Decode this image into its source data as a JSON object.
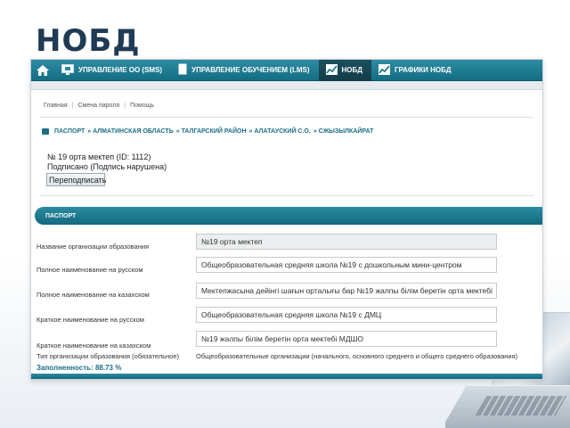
{
  "slide": {
    "title": "НОБД"
  },
  "nav": {
    "items": [
      {
        "label": "УПРАВЛЕНИЕ ОО (SMS)",
        "icon": "monitor-icon",
        "active": false
      },
      {
        "label": "УПРАВЛЕНИЕ ОБУЧЕНИЕМ (LMS)",
        "icon": "document-icon",
        "active": false
      },
      {
        "label": "НОБД",
        "icon": "chart-icon",
        "active": true
      },
      {
        "label": "ГРАФИКИ НОБД",
        "icon": "chart-icon",
        "active": false
      }
    ]
  },
  "top_links": [
    "Главная",
    "Смена пароля",
    "Помощь"
  ],
  "breadcrumb": [
    "ПАСПОРТ",
    "» АЛМАТИНСКАЯ ОБЛАСТЬ",
    "» ТАЛГАРСКИЙ РАЙОН",
    "» АЛАТАУСКИЙ С.О.",
    "» СЖЫЗЫЛКАЙРАТ"
  ],
  "status": {
    "line1": "№ 19 орта мектеп (ID: 1112)",
    "line2": "Подписано (Подпись нарушена)"
  },
  "resign_button": "Переподписать",
  "section": {
    "title": "ПАСПОРТ"
  },
  "form": [
    {
      "label": "Название организации образования",
      "value": "№19 орта мектеп"
    },
    {
      "label": "Полное наименование на русском",
      "value": "Общеобразовательная средняя школа №19 с дошкольным мини-центром"
    },
    {
      "label": "Полное наименование на казахском",
      "value": "Мектепжасына дейінгі шағын орталығы бар №19 жалпы білім беретін орта мектебі"
    },
    {
      "label": "Краткое наименование на русском",
      "value": "Общеобразовательная средняя школа №19 с ДМЦ"
    },
    {
      "label": "Краткое наименование на казахском",
      "value": "№19 жалпы білім беретін орта мектебі МДШО"
    },
    {
      "label": "Тип организации образования (обязательное)",
      "value": "Общеобразовательные организации (начального, основного среднего и общего среднего образования)"
    }
  ],
  "completeness": "Заполненность: 88.73 %",
  "colors": {
    "nav_bar": "#136d83",
    "accent": "#1b6f86",
    "title": "#1f3a55"
  }
}
